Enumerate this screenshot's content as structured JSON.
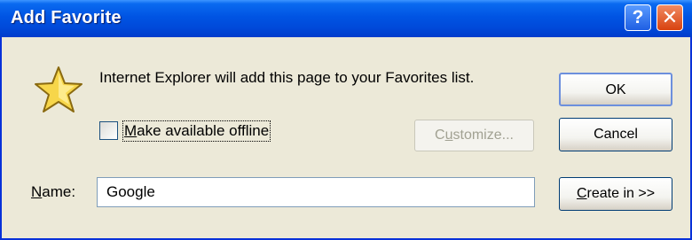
{
  "window": {
    "title": "Add Favorite"
  },
  "titlebar": {
    "help_glyph": "?",
    "close_glyph": "✕"
  },
  "message": "Internet Explorer will add this page to your Favorites list.",
  "offline": {
    "label_mnemonic": "M",
    "label_rest": "ake available offline",
    "checked": false
  },
  "buttons": {
    "ok": "OK",
    "cancel": "Cancel",
    "customize_pre": "C",
    "customize_mn": "u",
    "customize_post": "stomize...",
    "create_mn": "C",
    "create_rest": "reate in >>"
  },
  "name": {
    "label_mnemonic": "N",
    "label_rest": "ame:",
    "value": "Google"
  },
  "icons": {
    "favorite": "star-icon",
    "help": "help-icon",
    "close": "close-icon"
  },
  "colors": {
    "titlebar": "#0054e3",
    "face": "#ece9d8",
    "star": "#f7d64a",
    "close": "#d8420f"
  }
}
